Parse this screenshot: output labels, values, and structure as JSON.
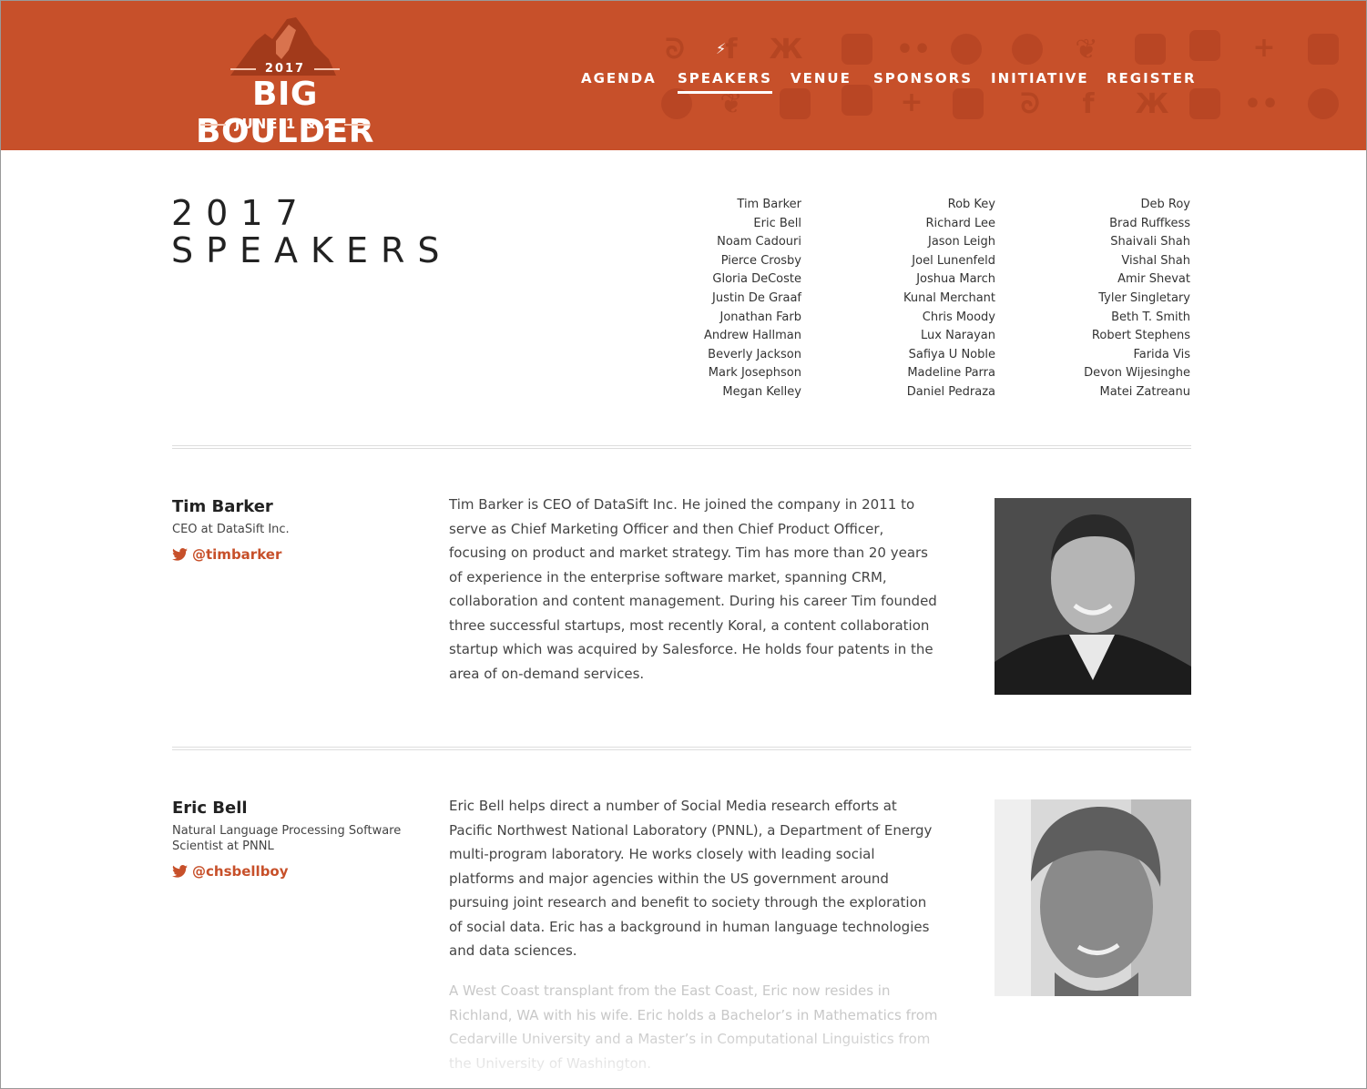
{
  "header": {
    "logo": {
      "year": "2017",
      "title": "BIG BOULDER",
      "dates": "JUNE 1 & 2"
    },
    "nav": [
      {
        "label": "AGENDA"
      },
      {
        "label": "SPEAKERS",
        "active": true
      },
      {
        "label": "VENUE"
      },
      {
        "label": "SPONSORS"
      },
      {
        "label": "INITIATIVE"
      },
      {
        "label": "REGISTER"
      }
    ],
    "accent_color": "#c7502a",
    "background_icons": [
      "stumbleupon-icon",
      "facebook-icon",
      "odnoklassniki-icon",
      "delicious-icon",
      "flickr-icon",
      "wordpress-icon",
      "gnip-icon",
      "twitter-icon",
      "pinterest-icon",
      "youtube-icon",
      "plus-icon",
      "tumblr-icon"
    ]
  },
  "page": {
    "title_line1": "2017",
    "title_line2": "SPEAKERS"
  },
  "speaker_index": [
    [
      "Tim Barker",
      "Eric Bell",
      "Noam Cadouri",
      "Pierce Crosby",
      "Gloria DeCoste",
      "Justin De Graaf",
      "Jonathan Farb",
      "Andrew Hallman",
      "Beverly Jackson",
      "Mark Josephson",
      "Megan Kelley"
    ],
    [
      "Rob Key",
      "Richard Lee",
      "Jason Leigh",
      "Joel Lunenfeld",
      "Joshua March",
      "Kunal Merchant",
      "Chris Moody",
      "Lux Narayan",
      "Safiya U Noble",
      "Madeline Parra",
      "Daniel Pedraza"
    ],
    [
      "Deb Roy",
      "Brad Ruffkess",
      "Shaivali Shah",
      "Vishal Shah",
      "Amir Shevat",
      "Tyler Singletary",
      "Beth T. Smith",
      "Robert Stephens",
      "Farida Vis",
      "Devon Wijesinghe",
      "Matei Zatreanu"
    ]
  ],
  "speakers": [
    {
      "name": "Tim Barker",
      "role": "CEO at DataSift Inc.",
      "twitter": "@timbarker",
      "bio": "Tim Barker is CEO of DataSift Inc. He joined the company in 2011 to serve as Chief Marketing Officer and then Chief Product Officer, focusing on product and market strategy. Tim has more than 20 years of experience in the enterprise software market, spanning CRM, collaboration and content management. During his career Tim founded three successful startups, most recently Koral, a content collaboration startup which was acquired by Salesforce. He holds four patents in the area of on-demand services."
    },
    {
      "name": "Eric Bell",
      "role": "Natural Language Processing Software Scientist at PNNL",
      "twitter": "@chsbellboy",
      "bio": "Eric Bell helps direct a number of Social Media research efforts at Pacific Northwest National Laboratory (PNNL), a Department of Energy multi-program laboratory. He works closely with leading social platforms and major agencies within the US government around pursuing joint research and benefit to society through the exploration of social data. Eric has a background in human language technologies and data sciences.",
      "bio_more": "A West Coast transplant from the East Coast, Eric now resides in Richland, WA with his wife. Eric holds a Bachelor’s in Mathematics from Cedarville University and a Master’s in Computational Linguistics from the University of Washington."
    }
  ]
}
